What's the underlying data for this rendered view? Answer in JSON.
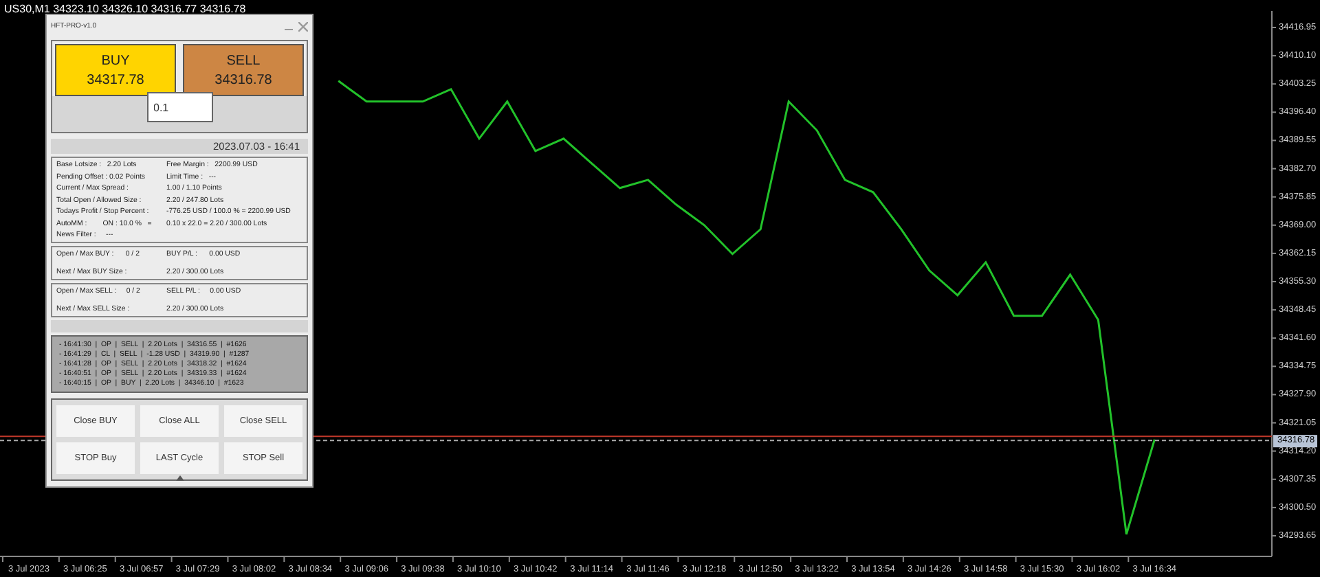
{
  "symbol_header": "US30,M1  34323.10 34326.10 34316.77 34316.78",
  "chart": {
    "current_price": "34316.78",
    "chart_data": {
      "type": "line",
      "categories": [
        "3 Jul 2023",
        null,
        "3 Jul 06:25",
        null,
        "3 Jul 06:57",
        null,
        "3 Jul 07:29",
        null,
        "3 Jul 08:02",
        null,
        "3 Jul 08:34",
        null,
        "3 Jul 09:06",
        null,
        "3 Jul 09:38",
        null,
        "3 Jul 10:10",
        null,
        "3 Jul 10:42",
        null,
        "3 Jul 11:14",
        null,
        "3 Jul 11:46",
        null,
        "3 Jul 12:18",
        null,
        "3 Jul 12:50",
        null,
        "3 Jul 13:22",
        null,
        "3 Jul 13:54",
        null,
        "3 Jul 14:26",
        null,
        "3 Jul 14:58",
        null,
        "3 Jul 15:30",
        null,
        "3 Jul 16:02",
        null,
        "3 Jul 16:34",
        null,
        null,
        null,
        null,
        null
      ],
      "series": [
        {
          "color": "#22c22a",
          "values": [
            null,
            null,
            null,
            null,
            null,
            null,
            null,
            null,
            null,
            null,
            null,
            34404,
            34399,
            34399,
            34399,
            34402,
            34390,
            34399,
            34387,
            34390,
            34384,
            34378,
            34380,
            34374,
            34369,
            34362,
            34368,
            34399,
            34392,
            34380,
            34377,
            34368,
            34358,
            34352,
            34360,
            34347,
            34347,
            34357,
            34346,
            34294,
            34317,
            null,
            null,
            null,
            null,
            null
          ]
        }
      ],
      "ylim": [
        34288.65,
        34420.95
      ],
      "ref_lines": [
        {
          "axis": "y",
          "value": 34317.78,
          "color": "#c0392b"
        },
        {
          "axis": "y",
          "value": 34316.78,
          "color": "#aaaaaa"
        }
      ],
      "yticks": [
        {
          "value": 34416.95,
          "label": "34416.95"
        },
        {
          "value": 34410.1,
          "label": "34410.10"
        },
        {
          "value": 34403.25,
          "label": "34403.25"
        },
        {
          "value": 34396.4,
          "label": "34396.40"
        },
        {
          "value": 34389.55,
          "label": "34389.55"
        },
        {
          "value": 34382.7,
          "label": "34382.70"
        },
        {
          "value": 34375.85,
          "label": "34375.85"
        },
        {
          "value": 34369,
          "label": "34369.00"
        },
        {
          "value": 34362.15,
          "label": "34362.15"
        },
        {
          "value": 34355.3,
          "label": "34355.30"
        },
        {
          "value": 34348.45,
          "label": "34348.45"
        },
        {
          "value": 34341.6,
          "label": "34341.60"
        },
        {
          "value": 34334.75,
          "label": "34334.75"
        },
        {
          "value": 34327.9,
          "label": "34327.90"
        },
        {
          "value": 34321.05,
          "label": "34321.05"
        },
        {
          "value": 34314.2,
          "label": "34314.20"
        },
        {
          "value": 34307.35,
          "label": "34307.35"
        },
        {
          "value": 34300.5,
          "label": "34300.50"
        },
        {
          "value": 34293.65,
          "label": "34293.65"
        }
      ]
    }
  },
  "panel": {
    "title": "HFT-PRO-v1.0",
    "buy": {
      "label": "BUY",
      "price": "34317.78"
    },
    "sell": {
      "label": "SELL",
      "price": "34316.78"
    },
    "lot": "0.1",
    "datetime": "2023.07.03 - 16:41",
    "info": [
      {
        "left": "Base Lotsize :   2.20 Lots",
        "right": "Free Margin :   2200.99 USD"
      },
      {
        "left": "Pending Offset : 0.02 Points",
        "right": "Limit Time :   ---"
      },
      {
        "left": "Current / Max Spread :",
        "right": "1.00 / 1.10 Points"
      },
      {
        "left": "Total Open / Allowed Size :",
        "right": "2.20 / 247.80 Lots"
      },
      {
        "left": "Todays Profit / Stop Percent :",
        "right": "-776.25 USD / 100.0 % = 2200.99 USD"
      },
      {
        "left": "AutoMM :        ON : 10.0 %   =",
        "right": "0.10 x 22.0 = 2.20 / 300.00 Lots"
      },
      {
        "left": "News Filter :     ---"
      }
    ],
    "sections": [
      {
        "rows": [
          {
            "left": "Open / Max BUY :      0 / 2",
            "right": "BUY P/L :      0.00 USD"
          },
          {
            "left": "Next / Max BUY Size :",
            "right": "2.20 / 300.00 Lots"
          }
        ]
      },
      {
        "rows": [
          {
            "left": "Open / Max SELL :     0 / 2",
            "right": "SELL P/L :     0.00 USD"
          },
          {
            "left": "Next / Max SELL Size :",
            "right": "2.20 / 300.00 Lots"
          }
        ]
      }
    ],
    "log": [
      "- 16:41:30  |  OP  |  SELL  |  2.20 Lots  |  34316.55  |  #1626",
      "- 16:41:29  |  CL  |  SELL  |  -1.28 USD  |  34319.90  |  #1287",
      "- 16:41:28  |  OP  |  SELL  |  2.20 Lots  |  34318.32  |  #1624",
      "- 16:40:51  |  OP  |  SELL  |  2.20 Lots  |  34319.33  |  #1624",
      "- 16:40:15  |  OP  |  BUY  |  2.20 Lots  |  34346.10  |  #1623"
    ],
    "buttons": [
      "Close BUY",
      "Close ALL",
      "Close SELL",
      "STOP Buy",
      "LAST Cycle",
      "STOP Sell"
    ]
  }
}
